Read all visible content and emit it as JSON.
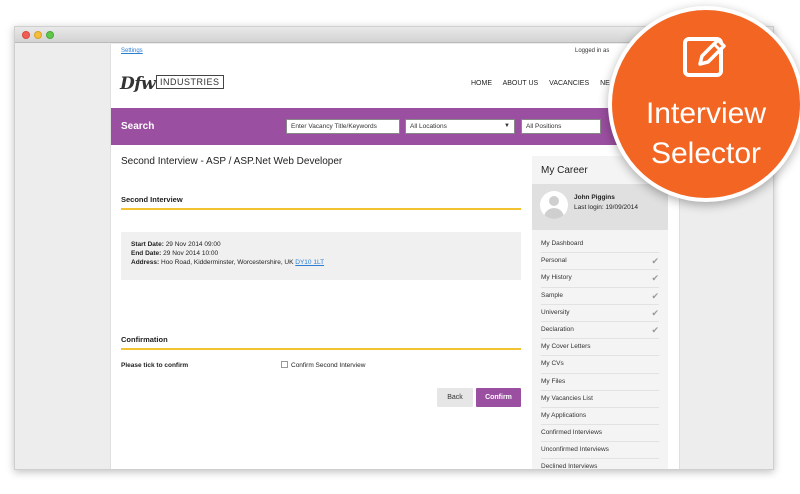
{
  "topbar": {
    "settings": "Settings",
    "logged_in": "Logged in as"
  },
  "logo": {
    "dfw": "Dfw",
    "industries": "INDUSTRIES"
  },
  "nav": [
    "HOME",
    "ABOUT US",
    "VACANCIES",
    "NE"
  ],
  "search": {
    "title": "Search",
    "keywords_placeholder": "Enter Vacancy Title/Keywords",
    "locations": "All Locations",
    "positions": "All Positions"
  },
  "main": {
    "job_title": "Second Interview - ASP / ASP.Net Web Developer",
    "section1": "Second Interview",
    "start_label": "Start Date:",
    "start_value": "29 Nov 2014 09:00",
    "end_label": "End Date:",
    "end_value": "29 Nov 2014 10:00",
    "address_label": "Address:",
    "address_value": "Hoo Road, Kidderminster, Worcestershire, UK",
    "postcode": "DY10 1LT",
    "section2": "Confirmation",
    "tick_label": "Please tick to confirm",
    "checkbox_label": "Confirm Second Interview",
    "back": "Back",
    "confirm": "Confirm"
  },
  "sidebar": {
    "title": "My Career",
    "name": "John Piggins",
    "last_login": "Last login: 19/09/2014",
    "items": [
      {
        "label": "My Dashboard",
        "tick": ""
      },
      {
        "label": "Personal",
        "tick": "✔"
      },
      {
        "label": "My History",
        "tick": "✔"
      },
      {
        "label": "Sample",
        "tick": "✔"
      },
      {
        "label": "University",
        "tick": "✔"
      },
      {
        "label": "Declaration",
        "tick": "✔"
      },
      {
        "label": "My Cover Letters",
        "tick": ""
      },
      {
        "label": "My CVs",
        "tick": ""
      },
      {
        "label": "My Files",
        "tick": ""
      },
      {
        "label": "My Vacancies List",
        "tick": ""
      },
      {
        "label": "My Applications",
        "tick": ""
      },
      {
        "label": "Confirmed Interviews",
        "tick": ""
      },
      {
        "label": "Unconfirmed Interviews",
        "tick": ""
      },
      {
        "label": "Declined Interviews",
        "tick": ""
      }
    ]
  },
  "badge": {
    "line1": "Interview",
    "line2": "Selector",
    "icon": "pencil-edit-icon"
  },
  "colors": {
    "brand_purple": "#9b4fa0",
    "accent_yellow": "#f2c230",
    "badge_orange": "#f26522",
    "link_blue": "#2a7fd4"
  }
}
